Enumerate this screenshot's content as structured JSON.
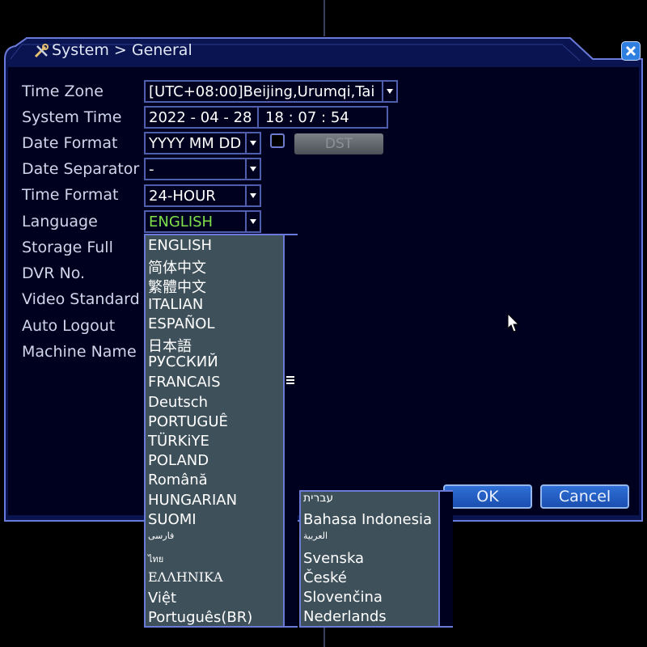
{
  "window": {
    "title": "System > General",
    "title_icon": "wrench-screwdriver-icon",
    "close_icon": "close-icon"
  },
  "rows": [
    {
      "label": "Time Zone"
    },
    {
      "label": "System Time"
    },
    {
      "label": "Date Format"
    },
    {
      "label": "Date Separator"
    },
    {
      "label": "Time Format"
    },
    {
      "label": "Language"
    },
    {
      "label": "Storage Full"
    },
    {
      "label": "DVR No."
    },
    {
      "label": "Video Standard"
    },
    {
      "label": "Auto Logout"
    },
    {
      "label": "Machine Name"
    }
  ],
  "fields": {
    "time_zone": "[UTC+08:00]Beijing,Urumqi,Tai",
    "system_date": "2022 - 04 - 28",
    "system_clock": "18 : 07 : 54",
    "date_format": "YYYY MM DD",
    "date_separator": "-",
    "time_format": "24-HOUR",
    "language": "ENGLISH"
  },
  "colors": {
    "language_value": "#7fe04a",
    "accent_border": "#4f5fae",
    "list_bg": "#3e505a"
  },
  "dst_label": "DST",
  "buttons": {
    "ok": "OK",
    "cancel": "Cancel"
  },
  "language_list_1": [
    "ENGLISH",
    "简体中文",
    "繁體中文",
    "ITALIAN",
    "ESPAÑOL",
    "日本語",
    "РУССКИЙ",
    "FRANCAIS",
    "Deutsch",
    "PORTUGUÊ",
    "TÜRKiYE",
    "POLAND",
    "Română",
    "HUNGARIAN",
    "SUOMI",
    "فارسی",
    "ไทย",
    "ΕΛΛΗΝΙΚΑ",
    "Việt",
    "Português(BR)"
  ],
  "language_list_2": [
    "עברית",
    "Bahasa Indonesia",
    "العربية",
    "Svenska",
    "České",
    "Slovenčina",
    "Nederlands"
  ]
}
